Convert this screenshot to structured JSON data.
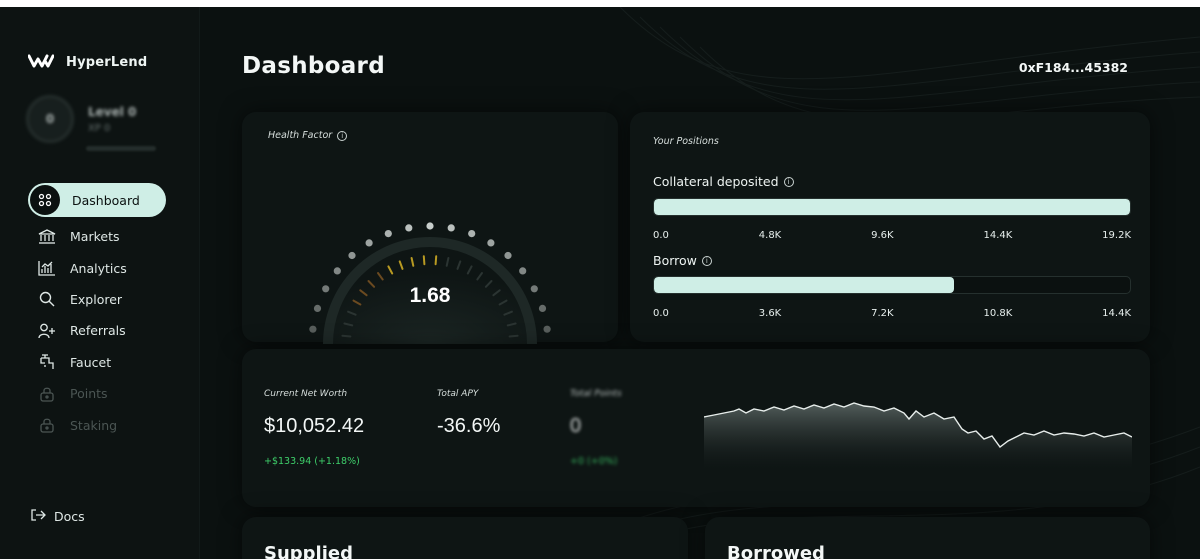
{
  "app": {
    "brand": "HyperLend"
  },
  "user": {
    "level_badge": "0",
    "level": "Level 0",
    "xp": "XP 0"
  },
  "sidebar": {
    "items": [
      {
        "label": "Dashboard",
        "icon": "dashboard-icon",
        "active": true
      },
      {
        "label": "Markets",
        "icon": "bank-icon"
      },
      {
        "label": "Analytics",
        "icon": "analytics-icon"
      },
      {
        "label": "Explorer",
        "icon": "search-icon"
      },
      {
        "label": "Referrals",
        "icon": "user-plus-icon"
      },
      {
        "label": "Faucet",
        "icon": "faucet-icon"
      },
      {
        "label": "Points",
        "icon": "lock-icon",
        "disabled": true
      },
      {
        "label": "Staking",
        "icon": "lock-icon",
        "disabled": true
      }
    ],
    "docs": "Docs"
  },
  "header": {
    "title": "Dashboard",
    "wallet": "0xF184...45382"
  },
  "health": {
    "label": "Health Factor",
    "value": "1.68"
  },
  "positions": {
    "label": "Your Positions",
    "collateral": {
      "label": "Collateral deposited",
      "fill_fraction": 1.0,
      "ticks": [
        "0.0",
        "4.8K",
        "9.6K",
        "14.4K",
        "19.2K"
      ]
    },
    "borrow": {
      "label": "Borrow",
      "fill_fraction": 0.63,
      "ticks": [
        "0.0",
        "3.6K",
        "7.2K",
        "10.8K",
        "14.4K"
      ]
    }
  },
  "networth": {
    "net_worth_label": "Current Net Worth",
    "net_worth_value": "$10,052.42",
    "net_worth_change": "+$133.94 (+1.18%)",
    "apy_label": "Total APY",
    "apy_value": "-36.6%",
    "points_label": "Total Points",
    "points_value": "0",
    "points_change": "+0 (+0%)"
  },
  "sections": {
    "supplied": "Supplied",
    "borrowed": "Borrowed"
  },
  "colors": {
    "accent": "#cfeee6",
    "background": "#0b1110",
    "positive": "#3ecf6a"
  }
}
